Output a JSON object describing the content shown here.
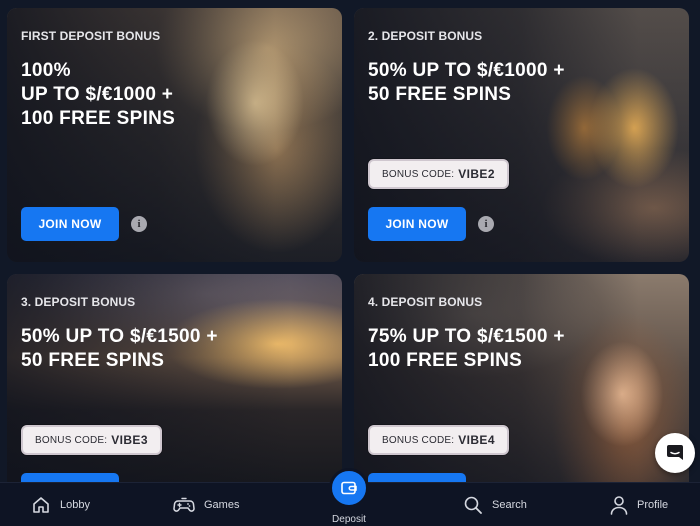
{
  "cards": [
    {
      "label": "FIRST DEPOSIT BONUS",
      "headline": [
        "100%",
        "UP TO $/€1000 +",
        "100 FREE SPINS"
      ],
      "button": "JOIN NOW",
      "info": "i"
    },
    {
      "label": "2. DEPOSIT BONUS",
      "headline": [
        "50% UP TO $/€1000 +",
        "50 FREE SPINS"
      ],
      "code_label": "BONUS CODE:",
      "code_value": "VIBE2",
      "button": "JOIN NOW",
      "info": "i"
    },
    {
      "label": "3. DEPOSIT BONUS",
      "headline": [
        "50% UP TO $/€1500 +",
        "50 FREE SPINS"
      ],
      "code_label": "BONUS CODE:",
      "code_value": "VIBE3"
    },
    {
      "label": "4. DEPOSIT BONUS",
      "headline": [
        "75% UP TO $/€1500 +",
        "100 FREE SPINS"
      ],
      "code_label": "BONUS CODE:",
      "code_value": "VIBE4"
    }
  ],
  "nav": {
    "lobby": "Lobby",
    "games": "Games",
    "deposit": "Deposit",
    "search": "Search",
    "profile": "Profile"
  },
  "icons": {
    "lobby": "home-icon",
    "games": "gamepad-icon",
    "deposit": "wallet-icon",
    "search": "search-icon",
    "profile": "user-icon",
    "chat": "chat-icon"
  },
  "colors": {
    "accent": "#1677f2",
    "nav_bg": "#0e1424",
    "code_pill_bg": "#f2eef0"
  }
}
